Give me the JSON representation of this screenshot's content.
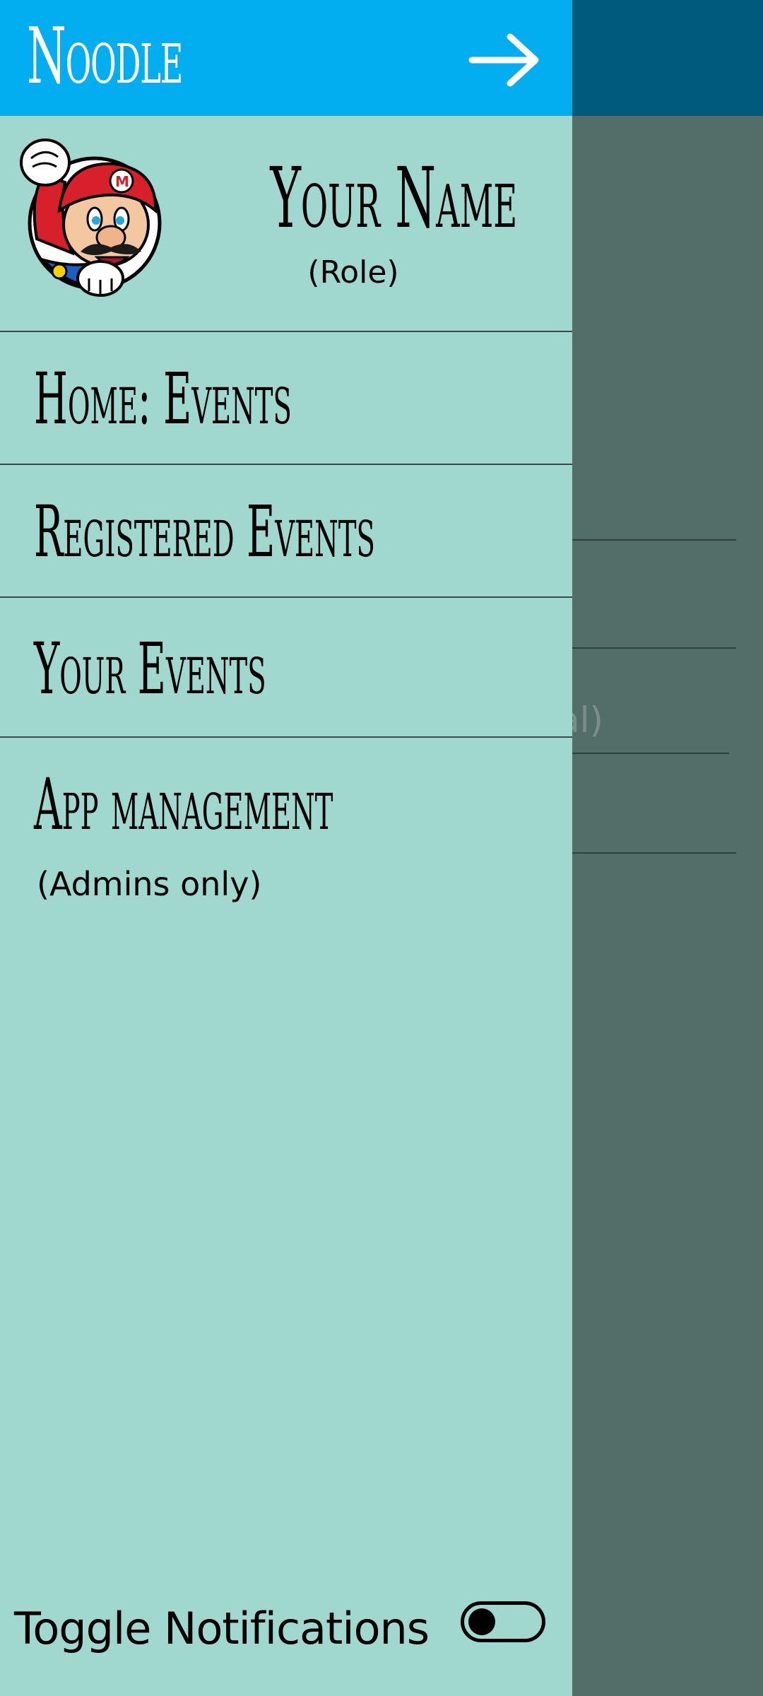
{
  "app": {
    "title": "Noodle"
  },
  "drawer": {
    "close_icon": "arrow-right-icon",
    "profile": {
      "name": "Your Name",
      "role": "(Role)",
      "avatar": "mario-avatar"
    },
    "items": [
      {
        "label": "Home: Events"
      },
      {
        "label": "Registered Events"
      },
      {
        "label": "Your Events"
      },
      {
        "label": "App management",
        "sublabel": "(Admins only)"
      }
    ],
    "toggle": {
      "label": "Toggle Notifications",
      "on": false
    }
  },
  "background": {
    "ghost_text": "al)"
  },
  "colors": {
    "drawer_bg": "#a0d7ce",
    "header_bg": "#03aef0",
    "scrim": "#536e68",
    "bg_appbar": "#005a7d"
  }
}
